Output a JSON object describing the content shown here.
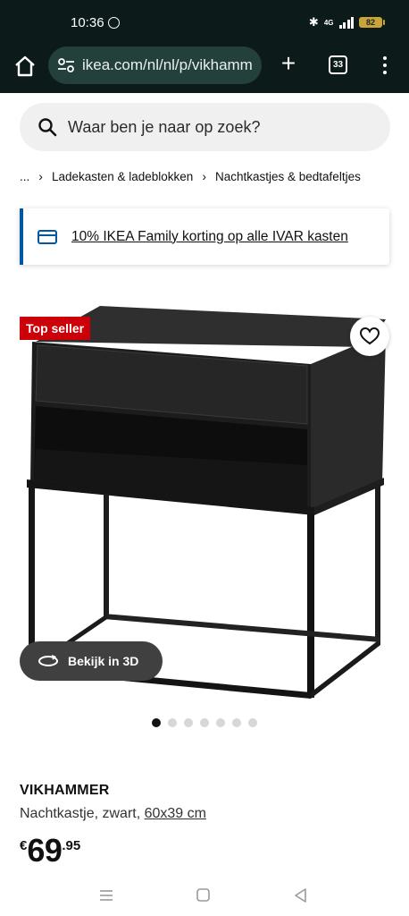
{
  "status_bar": {
    "time": "10:36",
    "network": "4G",
    "battery": "82",
    "icons": [
      "whatsapp-icon",
      "bluetooth-icon",
      "signal-icon",
      "battery-icon"
    ]
  },
  "browser": {
    "url": "ikea.com/nl/nl/p/vikhamm",
    "tab_count": "33",
    "icons": [
      "home-icon",
      "site-settings-icon",
      "plus-icon",
      "tabs-icon",
      "more-icon"
    ]
  },
  "search": {
    "placeholder": "Waar ben je naar op zoek?"
  },
  "breadcrumb": {
    "items": [
      "...",
      "Ladekasten & ladeblokken",
      "Nachtkastjes & bedtafeltjes"
    ]
  },
  "promo": {
    "text": "10% IKEA Family korting op alle IVAR kasten"
  },
  "product_image": {
    "badge": "Top seller",
    "view_3d_label": "Bekijk in 3D",
    "carousel_count": 7,
    "carousel_active": 1
  },
  "product": {
    "name": "VIKHAMMER",
    "description": "Nachtkastje, zwart,",
    "size_link": "60x39 cm",
    "price_currency": "€",
    "price_int": "69",
    "price_dec": ".95"
  },
  "colors": {
    "status_bg": "#0c1a1a",
    "url_bg": "#23403d",
    "badge": "#cc0008",
    "promo_accent": "#0058a3"
  }
}
